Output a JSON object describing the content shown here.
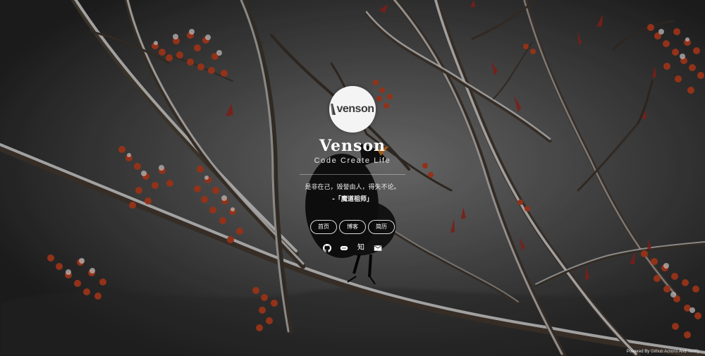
{
  "profile": {
    "avatar_logo_text": "venson",
    "name": "Venson",
    "tagline": "Code Create Life",
    "quote": "是非在己，毁誉由人，得失不论。",
    "quote_author": "-「魔道祖师」"
  },
  "nav": {
    "items": [
      {
        "label": "首页"
      },
      {
        "label": "博客"
      },
      {
        "label": "简历"
      }
    ]
  },
  "socials": {
    "github_icon": "github-icon",
    "csdn_icon": "csdn-icon",
    "zhihu_label": "知",
    "mail_icon": "mail-icon"
  },
  "footer": {
    "prefix": "Powered By ",
    "link1": "Github Actions",
    "middle": " And ",
    "link2": "Netlify"
  },
  "colors": {
    "berry": "#bf3d25",
    "snow": "#f7f7f7",
    "branch": "#4b3f34",
    "bird": "#111111"
  }
}
